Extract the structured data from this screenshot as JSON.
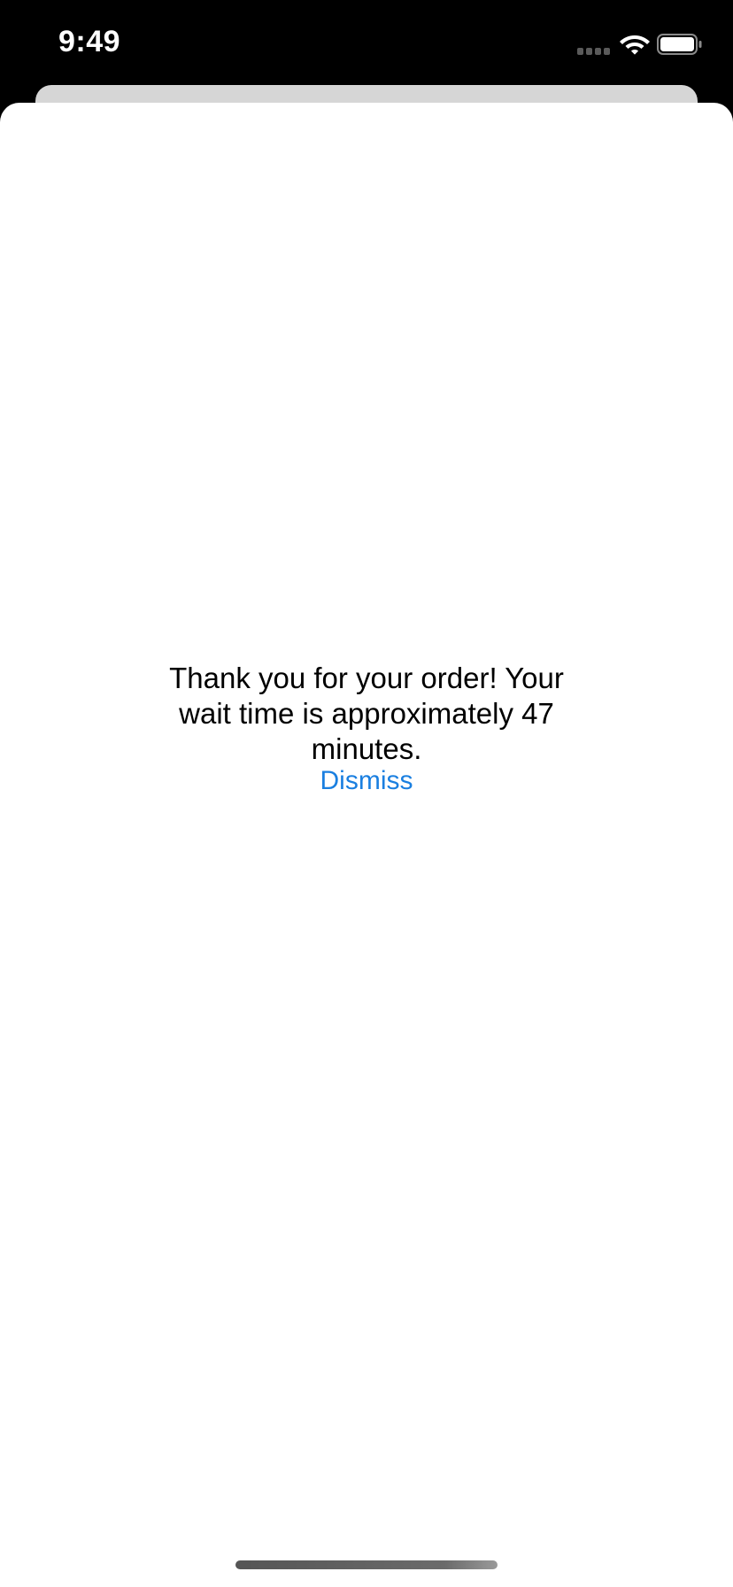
{
  "status_bar": {
    "time": "9:49",
    "icons": [
      "cellular-signal-icon",
      "wifi-icon",
      "battery-icon"
    ],
    "battery_level": 1.0
  },
  "sheet": {
    "message": "Thank you for your order! Your wait time is approximately 47 minutes.",
    "dismiss_label": "Dismiss"
  },
  "colors": {
    "status_bar_background": "#000000",
    "sheet_background": "#ffffff",
    "back_card": "#d6d6d6",
    "message_text": "#000000",
    "accent_link": "#1a7fe0"
  }
}
